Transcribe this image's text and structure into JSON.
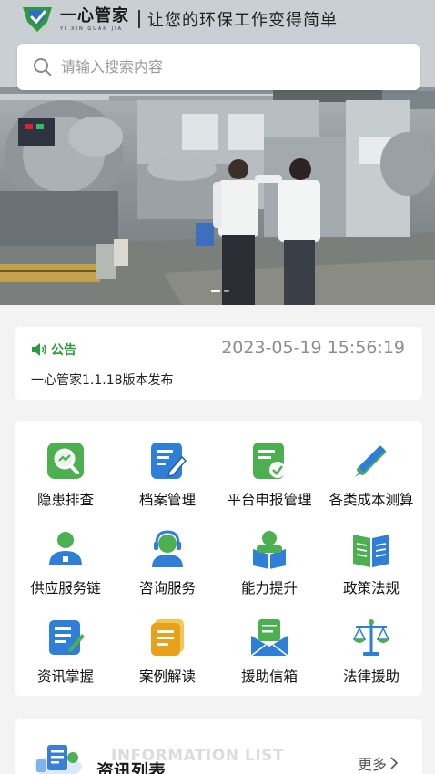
{
  "header": {
    "brand_name": "一心管家",
    "brand_pinyin": "YI XIN GUAN JIA",
    "slogan": "让您的环保工作变得简单"
  },
  "search": {
    "placeholder": "请输入搜索内容"
  },
  "banner": {
    "slide_count": 2,
    "active_slide": 1
  },
  "notice": {
    "tag": "公告",
    "timestamp": "2023-05-19 15:56:19",
    "message": "一心管家1.1.18版本发布"
  },
  "services": [
    {
      "label": "隐患排查",
      "icon": "magnifier-chart-icon",
      "color": "#4caf50"
    },
    {
      "label": "档案管理",
      "icon": "document-edit-icon",
      "color": "#2f7fd8"
    },
    {
      "label": "平台申报管理",
      "icon": "document-check-icon",
      "color": "#4caf50"
    },
    {
      "label": "各类成本测算",
      "icon": "ruler-pencil-icon",
      "color": "#4caf50"
    },
    {
      "label": "供应服务链",
      "icon": "user-network-icon",
      "color": "#2f7fd8"
    },
    {
      "label": "咨询服务",
      "icon": "headset-user-icon",
      "color": "#2f7fd8"
    },
    {
      "label": "能力提升",
      "icon": "reading-person-icon",
      "color": "#4caf50"
    },
    {
      "label": "政策法规",
      "icon": "open-book-icon",
      "color": "#4caf50"
    },
    {
      "label": "资讯掌握",
      "icon": "news-edit-icon",
      "color": "#2f7fd8"
    },
    {
      "label": "案例解读",
      "icon": "file-stack-icon",
      "color": "#e6a21a"
    },
    {
      "label": "援助信箱",
      "icon": "mail-letter-icon",
      "color": "#2f7fd8"
    },
    {
      "label": "法律援助",
      "icon": "balance-scale-icon",
      "color": "#2f7fd8"
    }
  ],
  "info": {
    "title": "资讯列表",
    "subtitle_en": "INFORMATION LIST",
    "more_label": "更多"
  },
  "colors": {
    "green": "#2e9b3a",
    "blue": "#2f7fd8",
    "bg": "#f3f3f3"
  }
}
